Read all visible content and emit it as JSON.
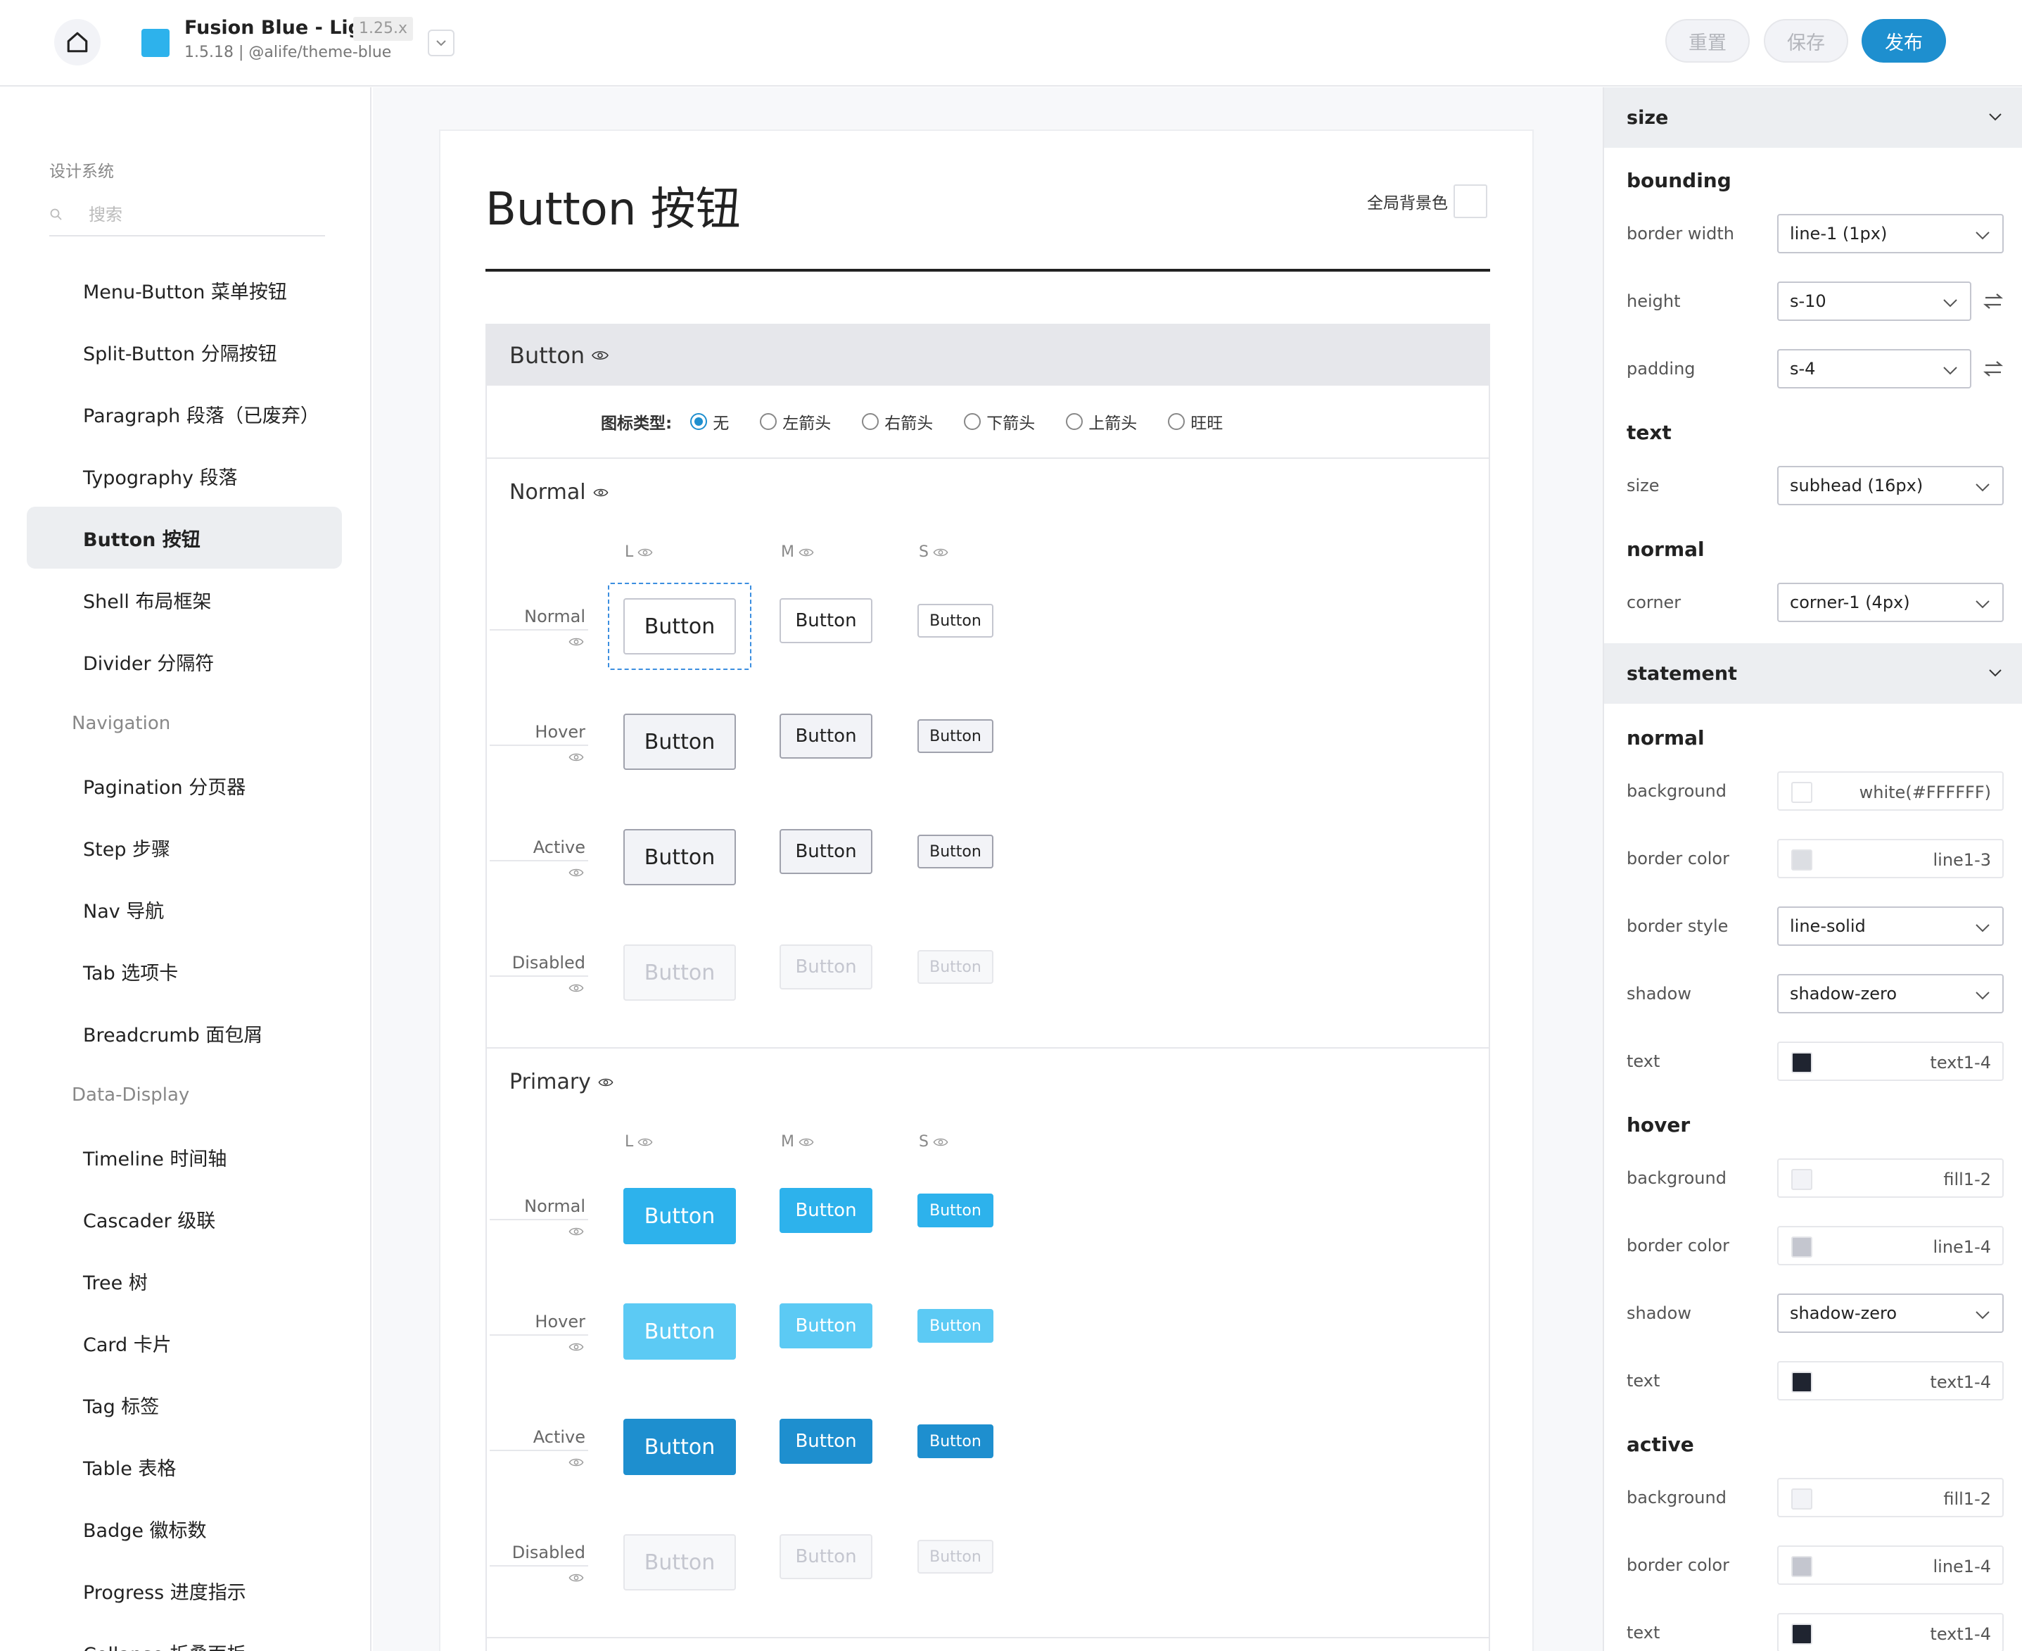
{
  "header": {
    "theme_name": "Fusion Blue - Light",
    "theme_version_badge": "1.25.x",
    "theme_package": "1.5.18 | @alife/theme-blue",
    "theme_color": "#2db2ec",
    "buttons": {
      "reset": "重置",
      "save": "保存",
      "publish": "发布"
    }
  },
  "sidebar": {
    "title": "设计系统",
    "search_placeholder": "搜索",
    "items": [
      {
        "type": "item",
        "label": "Menu-Button 菜单按钮"
      },
      {
        "type": "item",
        "label": "Split-Button 分隔按钮"
      },
      {
        "type": "item",
        "label": "Paragraph 段落（已废弃）"
      },
      {
        "type": "item",
        "label": "Typography 段落"
      },
      {
        "type": "item",
        "label": "Button 按钮",
        "active": true
      },
      {
        "type": "item",
        "label": "Shell 布局框架"
      },
      {
        "type": "item",
        "label": "Divider 分隔符"
      },
      {
        "type": "group",
        "label": "Navigation"
      },
      {
        "type": "item",
        "label": "Pagination 分页器"
      },
      {
        "type": "item",
        "label": "Step 步骤"
      },
      {
        "type": "item",
        "label": "Nav 导航"
      },
      {
        "type": "item",
        "label": "Tab 选项卡"
      },
      {
        "type": "item",
        "label": "Breadcrumb 面包屑"
      },
      {
        "type": "group",
        "label": "Data-Display"
      },
      {
        "type": "item",
        "label": "Timeline 时间轴"
      },
      {
        "type": "item",
        "label": "Cascader 级联"
      },
      {
        "type": "item",
        "label": "Tree 树"
      },
      {
        "type": "item",
        "label": "Card 卡片"
      },
      {
        "type": "item",
        "label": "Tag 标签"
      },
      {
        "type": "item",
        "label": "Table 表格"
      },
      {
        "type": "item",
        "label": "Badge 徽标数"
      },
      {
        "type": "item",
        "label": "Progress 进度指示"
      },
      {
        "type": "item",
        "label": "Collapse 折叠面板"
      }
    ]
  },
  "main": {
    "page_title": "Button 按钮",
    "bg_toggle_label": "全局背景色",
    "demo_title": "Button",
    "icon_type": {
      "label": "图标类型:",
      "options": [
        "无",
        "左箭头",
        "右箭头",
        "下箭头",
        "上箭头",
        "旺旺"
      ],
      "selected": "无"
    },
    "sizes": [
      "L",
      "M",
      "S"
    ],
    "states": [
      "Normal",
      "Hover",
      "Active",
      "Disabled"
    ],
    "button_text": "Button",
    "sections": [
      {
        "title": "Normal",
        "style": "normal"
      },
      {
        "title": "Primary",
        "style": "primary"
      }
    ]
  },
  "panel": {
    "size_head": "size",
    "bounding": {
      "title": "bounding",
      "border_width": {
        "label": "border width",
        "value": "line-1 (1px)"
      },
      "height": {
        "label": "height",
        "value": "s-10"
      },
      "padding": {
        "label": "padding",
        "value": "s-4"
      }
    },
    "text": {
      "title": "text",
      "size": {
        "label": "size",
        "value": "subhead (16px)"
      }
    },
    "normal": {
      "title": "normal",
      "corner": {
        "label": "corner",
        "value": "corner-1 (4px)"
      }
    },
    "statement_head": "statement",
    "st_normal": {
      "title": "normal",
      "background": {
        "label": "background",
        "value": "white(#FFFFFF)",
        "color": "#ffffff"
      },
      "border_color": {
        "label": "border color",
        "value": "line1-3",
        "color": "#dcdee3"
      },
      "border_style": {
        "label": "border style",
        "value": "line-solid"
      },
      "shadow": {
        "label": "shadow",
        "value": "shadow-zero"
      },
      "text": {
        "label": "text",
        "value": "text1-4",
        "color": "#1f2430"
      }
    },
    "st_hover": {
      "title": "hover",
      "background": {
        "label": "background",
        "value": "fill1-2",
        "color": "#f2f3f7"
      },
      "border_color": {
        "label": "border color",
        "value": "line1-4",
        "color": "#c4c6cf"
      },
      "shadow": {
        "label": "shadow",
        "value": "shadow-zero"
      },
      "text": {
        "label": "text",
        "value": "text1-4",
        "color": "#1f2430"
      }
    },
    "st_active": {
      "title": "active",
      "background": {
        "label": "background",
        "value": "fill1-2",
        "color": "#f2f3f7"
      },
      "border_color": {
        "label": "border color",
        "value": "line1-4",
        "color": "#c4c6cf"
      },
      "text": {
        "label": "text",
        "value": "text1-4",
        "color": "#1f2430"
      }
    }
  }
}
